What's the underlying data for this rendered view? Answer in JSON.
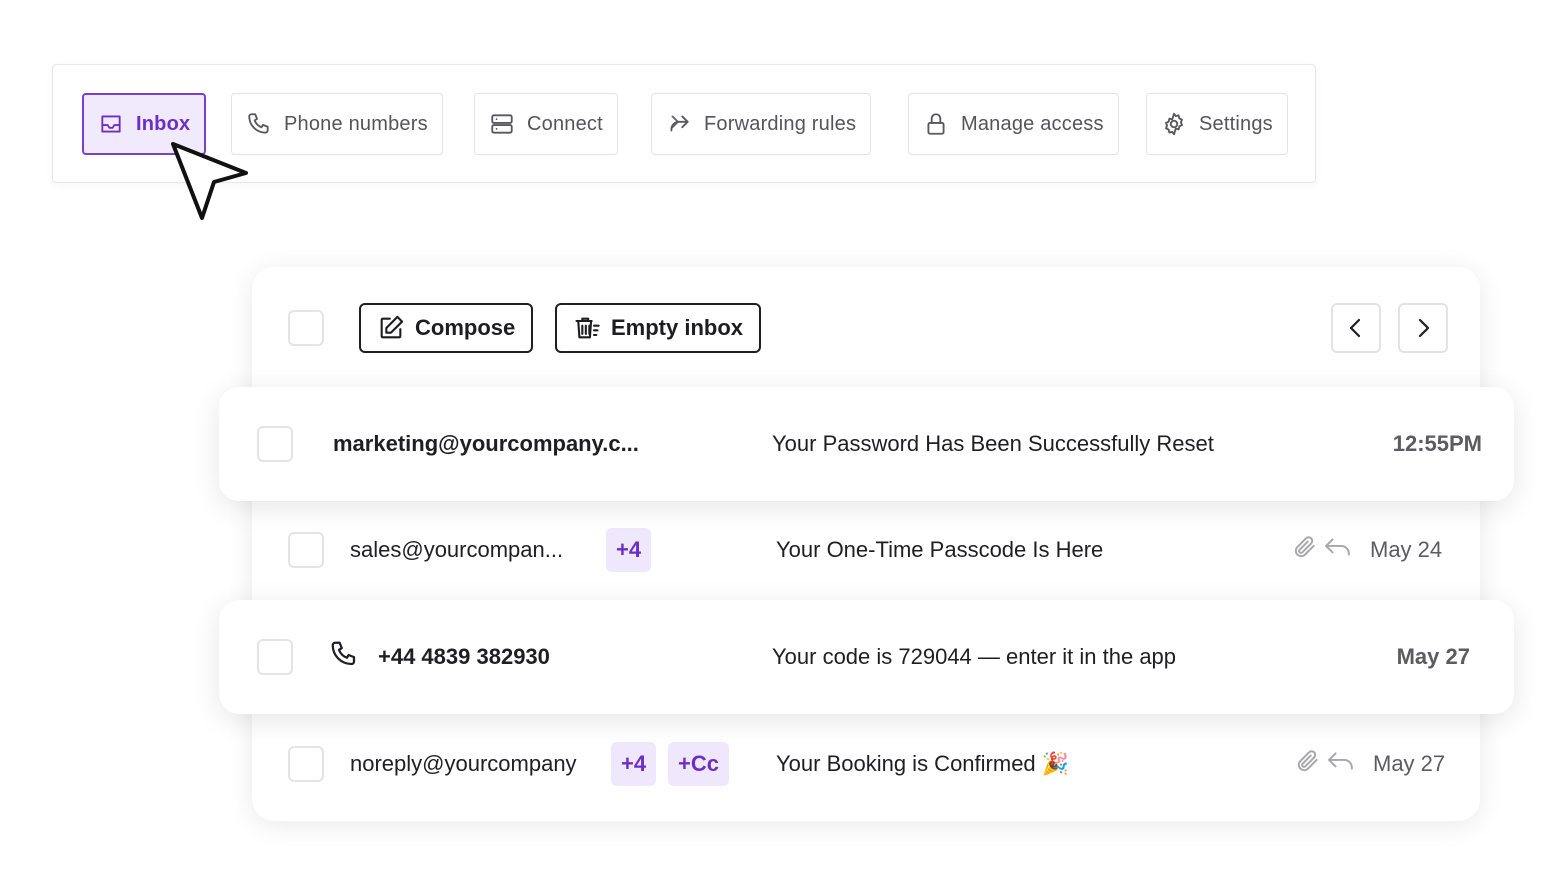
{
  "tabs": [
    {
      "label": "Inbox",
      "icon": "inbox-icon",
      "active": true
    },
    {
      "label": "Phone numbers",
      "icon": "phone-icon",
      "active": false
    },
    {
      "label": "Connect",
      "icon": "server-icon",
      "active": false
    },
    {
      "label": "Forwarding rules",
      "icon": "forward-icon",
      "active": false
    },
    {
      "label": "Manage access",
      "icon": "lock-icon",
      "active": false
    },
    {
      "label": "Settings",
      "icon": "gear-icon",
      "active": false
    }
  ],
  "toolbar": {
    "compose_label": "Compose",
    "empty_inbox_label": "Empty inbox"
  },
  "messages": [
    {
      "sender": "marketing@yourcompany.c...",
      "subject": "Your Password Has Been Successfully Reset",
      "time": "12:55PM",
      "unread": true
    },
    {
      "sender": "sales@yourcompan...",
      "badges": [
        "+4"
      ],
      "subject": "Your One-Time Passcode Is Here",
      "time": "May 24",
      "has_attachment": true,
      "replied": true
    },
    {
      "sender": "+44 4839 382930",
      "sender_type": "phone",
      "subject": "Your code is 729044 — enter it in the app",
      "time": "May 27",
      "unread": true
    },
    {
      "sender": "noreply@yourcompany",
      "badges": [
        "+4",
        "+Cc"
      ],
      "subject": "Your Booking is Confirmed 🎉",
      "time": "May 27",
      "has_attachment": true,
      "replied": true
    }
  ],
  "colors": {
    "accent": "#6c2ec8",
    "accent_bg": "#f1eafc",
    "badge_bg": "#efe7fc",
    "text": "#1f1f22"
  }
}
